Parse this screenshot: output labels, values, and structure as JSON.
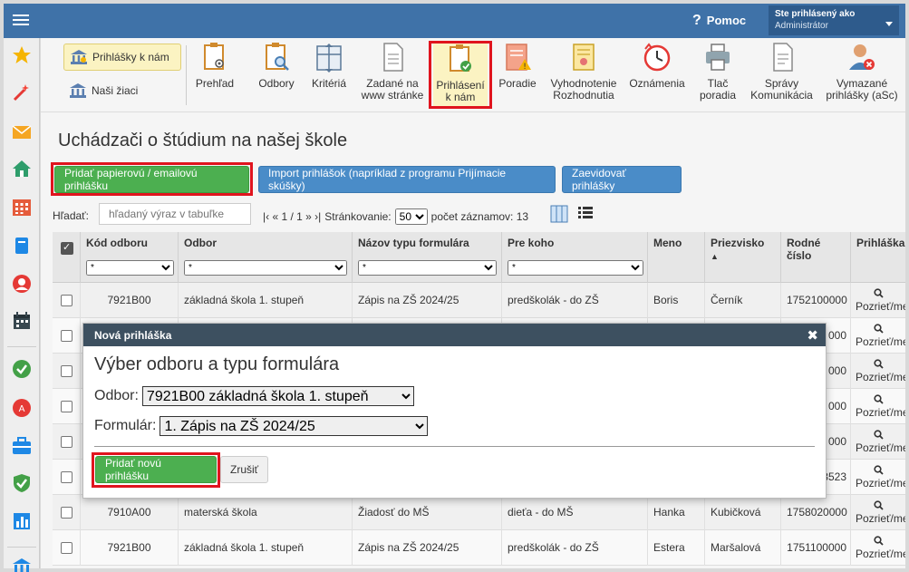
{
  "topbar": {
    "help_label": "Pomoc",
    "help_icon": "?",
    "user_line1": "Ste prihlásený ako",
    "user_line2": "Administrátor"
  },
  "toolbar": {
    "left_buttons": [
      "Prihlášky k nám",
      "Naši žiaci"
    ],
    "items": [
      {
        "l1": "Prehľad",
        "l2": "",
        "icon": "clipboard-eye-icon"
      },
      {
        "l1": "Odbory",
        "l2": "",
        "icon": "clipboard-search-icon"
      },
      {
        "l1": "Kritériá",
        "l2": "",
        "icon": "criteria-icon"
      },
      {
        "l1": "Zadané na",
        "l2": "www stránke",
        "icon": "document-icon"
      },
      {
        "l1": "Prihlásení",
        "l2": "k nám",
        "icon": "clipboard-check-icon"
      },
      {
        "l1": "Poradie",
        "l2": "",
        "icon": "warning-document-icon"
      },
      {
        "l1": "Vyhodnotenie",
        "l2": "Rozhodnutia",
        "icon": "certificate-icon"
      },
      {
        "l1": "Oznámenia",
        "l2": "",
        "icon": "clock-icon"
      },
      {
        "l1": "Tlač",
        "l2": "poradia",
        "icon": "printer-icon"
      },
      {
        "l1": "Správy",
        "l2": "Komunikácia",
        "icon": "messages-icon"
      },
      {
        "l1": "Vymazané",
        "l2": "prihlášky (aSc)",
        "icon": "deleted-user-icon"
      }
    ]
  },
  "page": {
    "title": "Uchádzači o štúdium na našej škole",
    "btn_add_paper": "Pridať papierovú / emailovú prihlášku",
    "btn_import": "Import prihlášok (napríklad z programu Prijímacie skúšky)",
    "btn_register": "Zaevidovať prihlášky",
    "search_label": "Hľadať:",
    "search_placeholder": "hľadaný výraz v tabuľke",
    "pager_nav": "|‹ « 1 / 1 » ›|",
    "pager_label": "Stránkovanie:",
    "pager_size": "50",
    "record_count": "počet záznamov: 13"
  },
  "table": {
    "headers": {
      "code": "Kód odboru",
      "field": "Odbor",
      "form": "Názov typu formulára",
      "for_whom": "Pre koho",
      "name": "Meno",
      "surname": "Priezvisko",
      "birth1": "Rodné",
      "birth2": "číslo",
      "app": "Prihláška"
    },
    "filter_value": "*",
    "sort_arrow": "▲",
    "view_label": "Pozrieť/me",
    "rows": [
      {
        "code": "7921B00",
        "field": "základná škola 1. stupeň",
        "form": "Zápis na ZŠ 2024/25",
        "for_whom": "predškolák - do ZŠ",
        "name": "Boris",
        "surname": "Černík",
        "birth": "1752100000"
      },
      {
        "code": "",
        "field": "",
        "form": "",
        "for_whom": "",
        "name": "",
        "surname": "",
        "birth": "000"
      },
      {
        "code": "",
        "field": "",
        "form": "",
        "for_whom": "",
        "name": "",
        "surname": "",
        "birth": "000"
      },
      {
        "code": "",
        "field": "",
        "form": "",
        "for_whom": "",
        "name": "",
        "surname": "",
        "birth": "000"
      },
      {
        "code": "",
        "field": "",
        "form": "",
        "for_whom": "",
        "name": "",
        "surname": "",
        "birth": "000"
      },
      {
        "code": "",
        "field": "",
        "form": "",
        "for_whom": "",
        "name": "",
        "surname": "",
        "birth": "3523"
      },
      {
        "code": "7910A00",
        "field": "materská škola",
        "form": "Žiadosť do MŠ",
        "for_whom": "dieťa - do MŠ",
        "name": "Hanka",
        "surname": "Kubičková",
        "birth": "1758020000"
      },
      {
        "code": "7921B00",
        "field": "základná škola 1. stupeň",
        "form": "Zápis na ZŠ 2024/25",
        "for_whom": "predškolák - do ZŠ",
        "name": "Estera",
        "surname": "Maršalová",
        "birth": "1751100000"
      }
    ]
  },
  "modal": {
    "header": "Nová prihláška",
    "close": "✖",
    "title": "Výber odboru a typu formulára",
    "field_label": "Odbor:",
    "field_value": "7921B00 základná škola 1. stupeň",
    "form_label": "Formulár:",
    "form_value": "1. Zápis na ZŠ 2024/25",
    "submit": "Pridať novú prihlášku",
    "cancel": "Zrušiť"
  },
  "colors": {
    "topbar": "#3f72a8",
    "green": "#4caf50",
    "blue": "#4a8cc8",
    "highlight": "#e0141e"
  }
}
